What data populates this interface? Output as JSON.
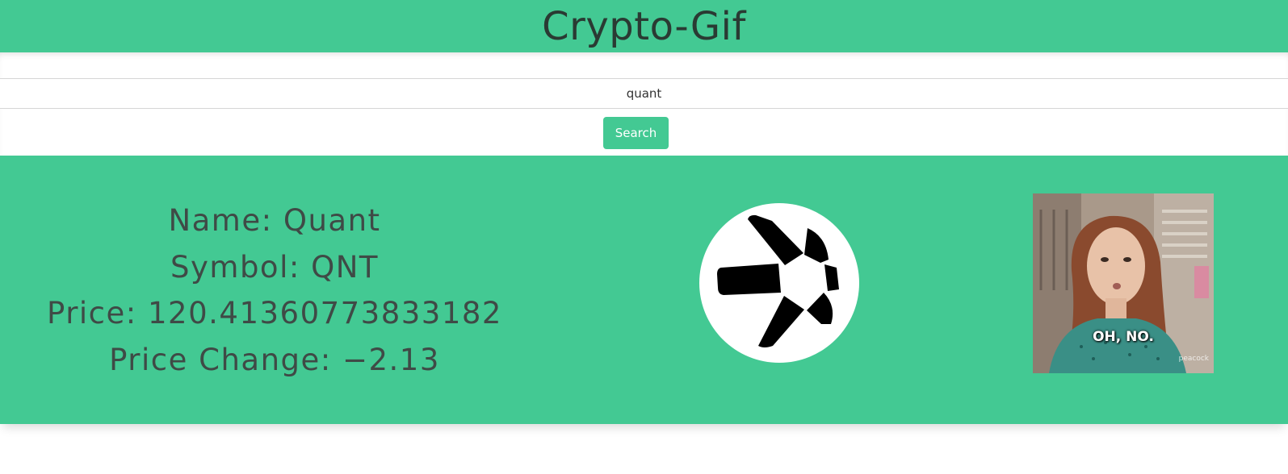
{
  "app": {
    "title": "Crypto-Gif"
  },
  "search": {
    "value": "quant",
    "button_label": "Search"
  },
  "coin": {
    "name_line": "Name: Quant",
    "symbol_line": "Symbol: QNT",
    "price_line": "Price: 120.41360773833182",
    "price_change_line": "Price Change: −2.13",
    "logo_icon": "quant-logo-icon"
  },
  "gif": {
    "caption": "OH, NO.",
    "watermark": "peacock"
  },
  "colors": {
    "accent": "#43c993",
    "text_dark": "#3f4a46",
    "header_text": "#2a3a33"
  }
}
